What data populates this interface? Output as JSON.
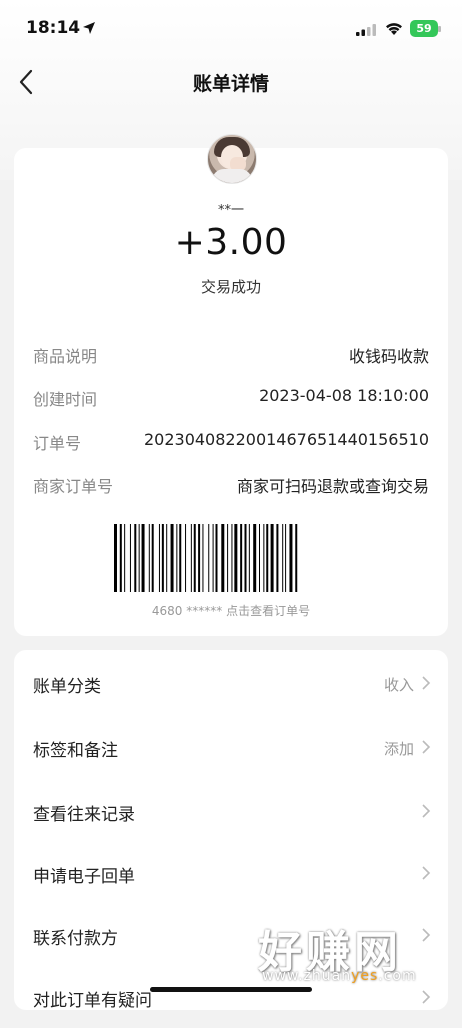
{
  "status_bar": {
    "time": "18:14",
    "battery": "59"
  },
  "nav": {
    "title": "账单详情"
  },
  "summary": {
    "payer_name": "**一",
    "amount": "+3.00",
    "status": "交易成功"
  },
  "details": [
    {
      "label": "商品说明",
      "value": "收钱码收款"
    },
    {
      "label": "创建时间",
      "value": "2023-04-08 18:10:00"
    },
    {
      "label": "订单号",
      "value": "2023040822001467651440156510"
    },
    {
      "label": "商家订单号",
      "value": "商家可扫码退款或查询交易"
    }
  ],
  "barcode_caption": "4680 ****** 点击查看订单号",
  "menu": [
    {
      "label": "账单分类",
      "value": "收入"
    },
    {
      "label": "标签和备注",
      "value": "添加"
    },
    {
      "label": "查看往来记录",
      "value": ""
    },
    {
      "label": "申请电子回单",
      "value": ""
    },
    {
      "label": "联系付款方",
      "value": ""
    },
    {
      "label": "对此订单有疑问",
      "value": ""
    }
  ],
  "watermark": {
    "name": "好赚网",
    "url_a": "www.zhuan",
    "url_b": "yes",
    "url_c": ".com"
  }
}
